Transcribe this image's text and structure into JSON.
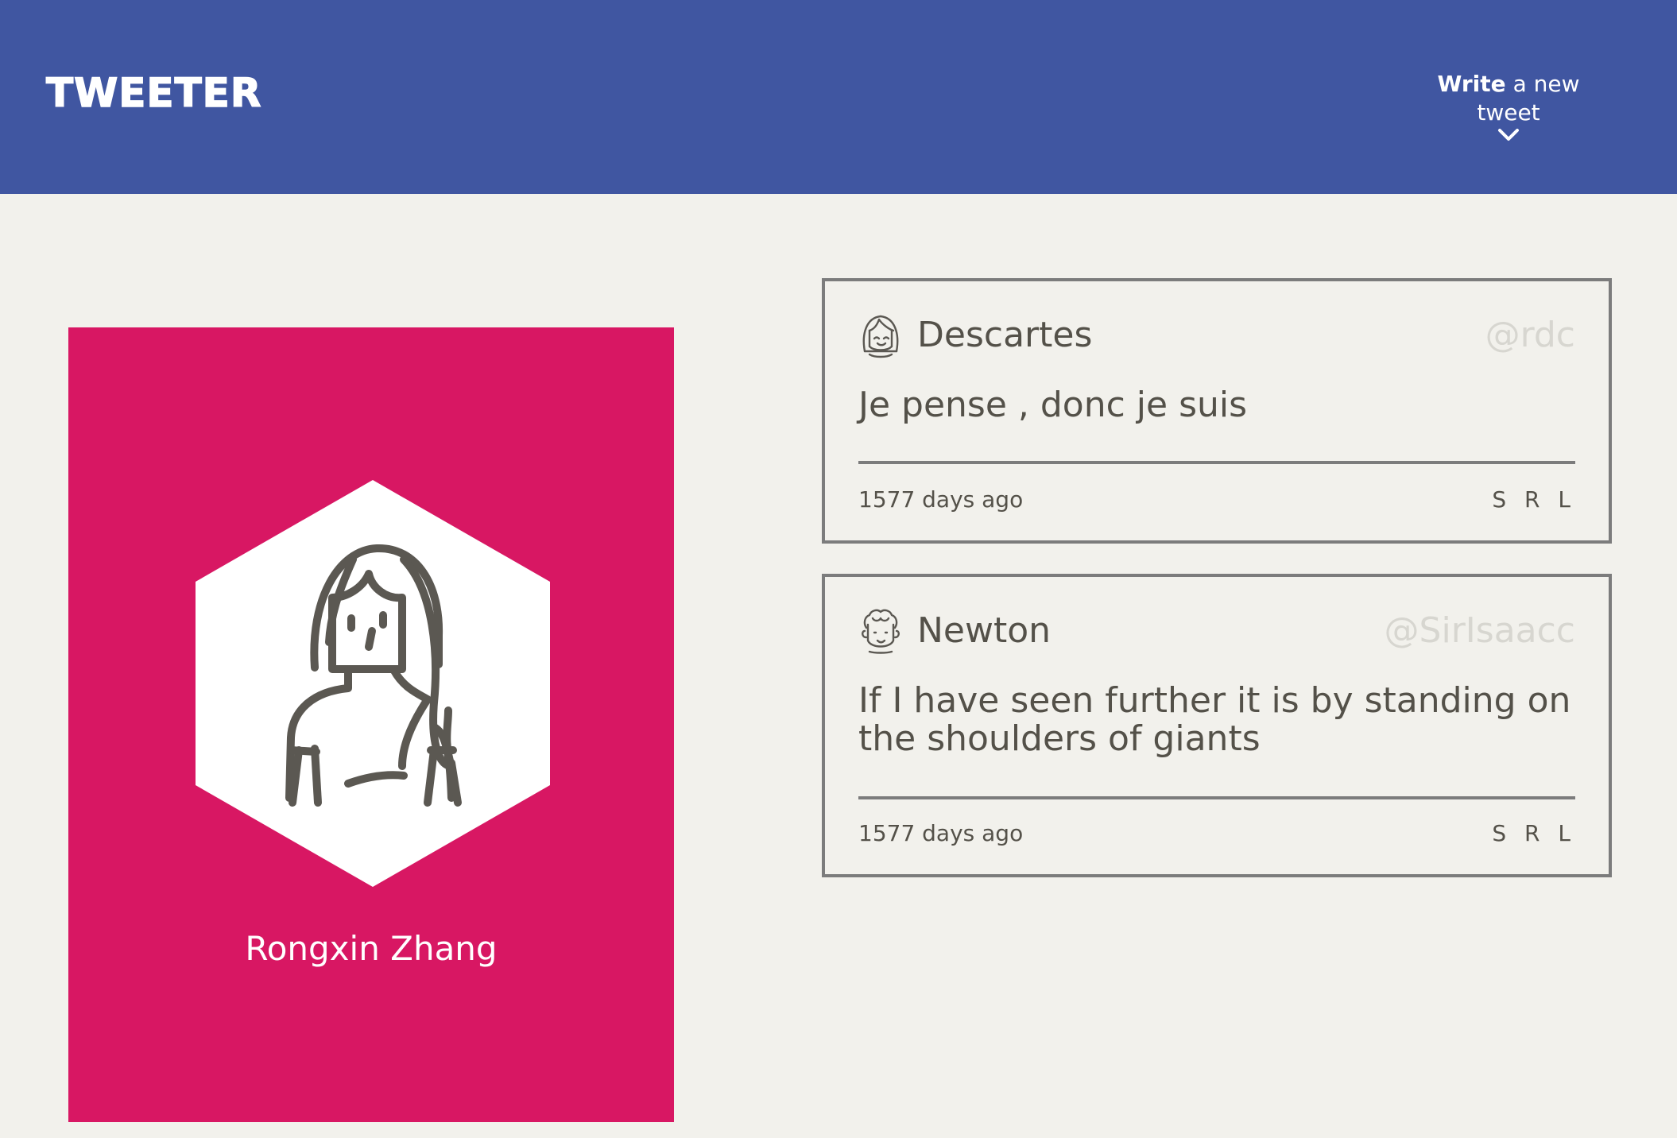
{
  "header": {
    "brand": "TWEETER",
    "compose": {
      "bold": "Write",
      "rest": " a new tweet",
      "icon": "chevron-down-icon"
    },
    "background": "#4056a1"
  },
  "profile": {
    "name": "Rongxin Zhang",
    "avatar_icon": "user-avatar-icon",
    "background": "#d81763"
  },
  "tweets": [
    {
      "avatar_icon": "avatar-girl-icon",
      "name": "Descartes",
      "handle": "@rdc",
      "text": "Je pense , donc je suis",
      "time": "1577 days ago",
      "actions": [
        "S",
        "R",
        "L"
      ]
    },
    {
      "avatar_icon": "avatar-curly-hair-icon",
      "name": "Newton",
      "handle": "@SirIsaacc",
      "text": "If I have seen further it is by standing on the shoulders of giants",
      "time": "1577 days ago",
      "actions": [
        "S",
        "R",
        "L"
      ]
    }
  ]
}
